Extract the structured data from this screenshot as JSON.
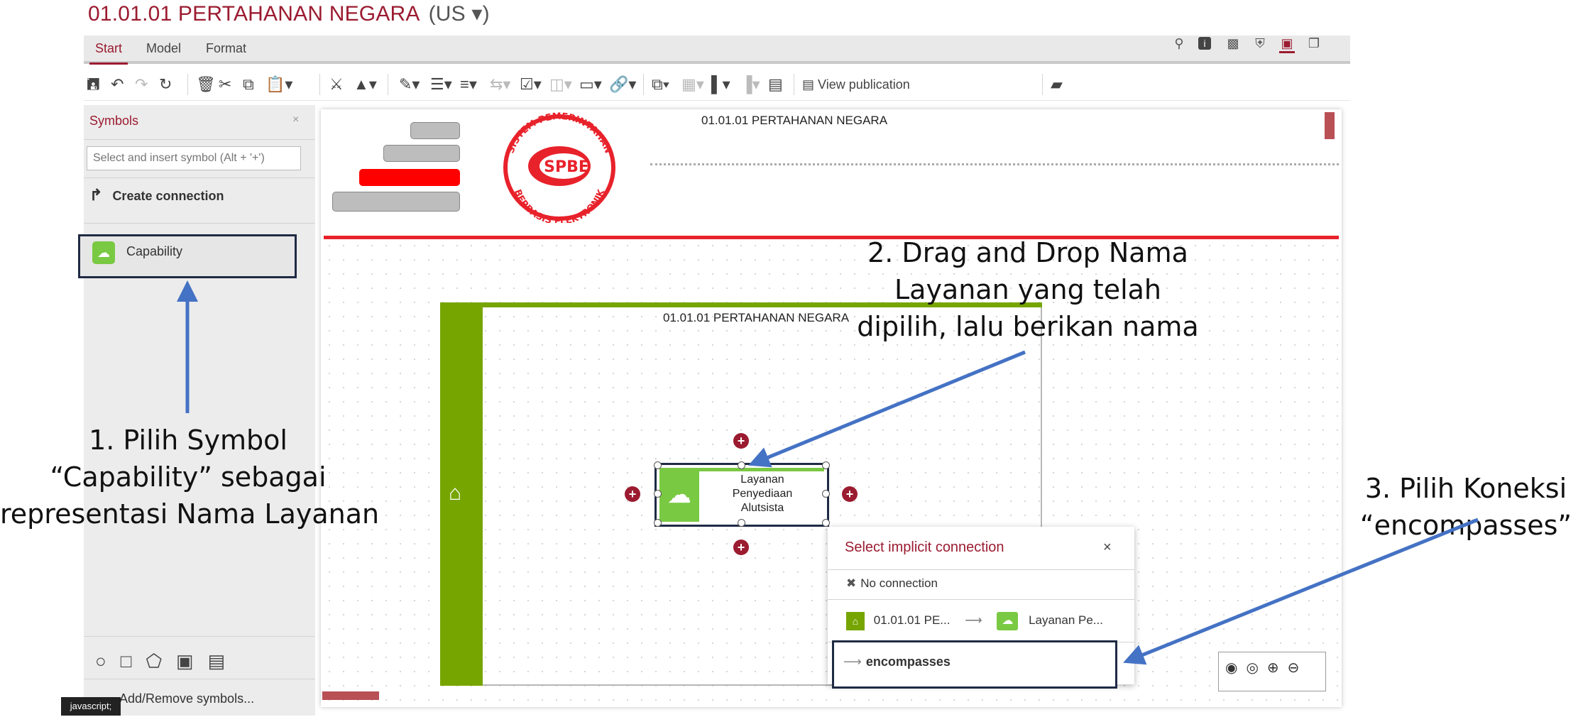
{
  "app": {
    "title": "01.01.01 PERTAHANAN NEGARA",
    "lang": "(US ▾)"
  },
  "tabs": [
    "Start",
    "Model",
    "Format"
  ],
  "toolbar": {
    "view_publication": "View publication"
  },
  "symbols_panel": {
    "title": "Symbols",
    "close": "×",
    "search_placeholder": "Select and insert symbol (Alt + '+')",
    "create_connection": "Create connection",
    "items": [
      {
        "label": "Capability"
      }
    ],
    "add_remove": "Add/Remove symbols..."
  },
  "status_bar": "javascript;",
  "canvas": {
    "header_title": "01.01.01 PERTAHANAN NEGARA",
    "logo": {
      "top_text": "SISTEM PEMERINTAHAN",
      "center_text": "SPBE",
      "bottom_text": "BERBASIS ELEKTRONIK"
    },
    "lane_title": "01.01.01 PERTAHANAN NEGARA",
    "capability_object": {
      "line1": "Layanan",
      "line2": "Penyediaan",
      "line3": "Alutsista"
    }
  },
  "popup": {
    "title": "Select implicit connection",
    "close": "×",
    "no_connection": "No connection",
    "source": "01.01.01 PE...",
    "target": "Layanan Pe...",
    "encompasses": "encompasses"
  },
  "annotations": {
    "step1": [
      "1. Pilih Symbol",
      "“Capability” sebagai",
      "representasi Nama Layanan"
    ],
    "step2": [
      "2. Drag and Drop Nama",
      "Layanan yang telah",
      "dipilih, lalu berikan nama"
    ],
    "step3": [
      "3. Pilih Koneksi",
      "“encompasses”"
    ]
  },
  "colors": {
    "brand": "#9b1b30",
    "lane_green": "#77a500",
    "capability_green": "#7ac943",
    "arrow_blue": "#4472c4",
    "header_red": "#e8222b"
  }
}
